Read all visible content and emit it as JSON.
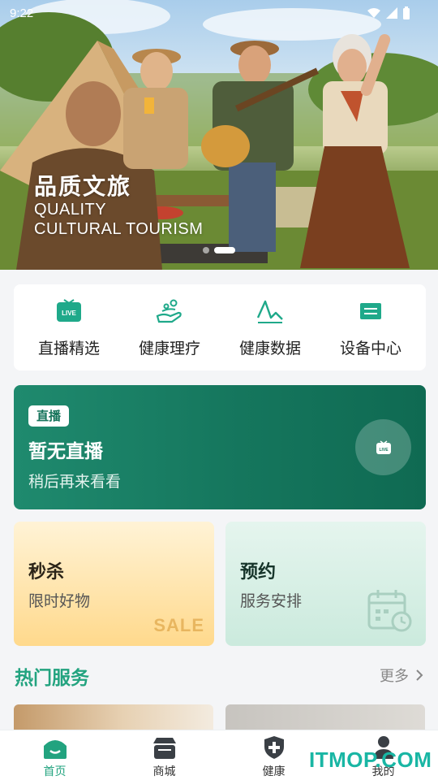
{
  "status_bar": {
    "time": "9:22"
  },
  "banner": {
    "title": "品质文旅",
    "subtitle_line1": "QUALITY",
    "subtitle_line2": "CULTURAL TOURISM",
    "slide_count": 2,
    "active_slide": 1
  },
  "quick_nav": [
    {
      "label": "直播精选",
      "icon": "live-tv-icon"
    },
    {
      "label": "健康理疗",
      "icon": "therapy-hand-icon"
    },
    {
      "label": "健康数据",
      "icon": "health-chart-icon"
    },
    {
      "label": "设备中心",
      "icon": "device-icon"
    }
  ],
  "live": {
    "badge": "直播",
    "title": "暂无直播",
    "subtitle": "稍后再来看看"
  },
  "promos": {
    "flash_sale": {
      "title": "秒杀",
      "subtitle": "限时好物",
      "decor_text": "SALE"
    },
    "booking": {
      "title": "预约",
      "subtitle": "服务安排"
    }
  },
  "hot_services": {
    "title": "热门服务",
    "more": "更多"
  },
  "tabbar": [
    {
      "label": "首页",
      "icon": "home-icon",
      "active": true
    },
    {
      "label": "商城",
      "icon": "shop-icon",
      "active": false
    },
    {
      "label": "健康",
      "icon": "health-shield-icon",
      "active": false
    },
    {
      "label": "我的",
      "icon": "profile-icon",
      "active": false
    }
  ],
  "watermark": "ITMOP.COM",
  "colors": {
    "accent": "#22a37f",
    "live_card": "#15765d",
    "sale_bg": "#ffd98c",
    "booking_bg": "#cbeadd"
  }
}
